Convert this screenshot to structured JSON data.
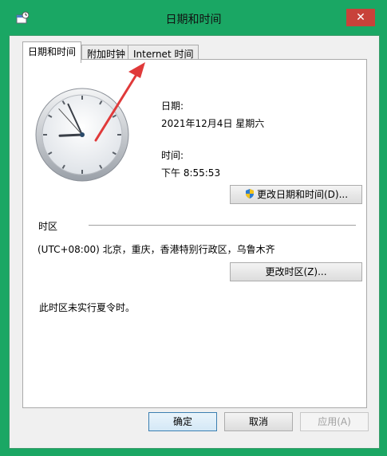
{
  "window": {
    "title": "日期和时间"
  },
  "tabs": [
    {
      "label": "日期和时间"
    },
    {
      "label": "附加时钟"
    },
    {
      "label": "Internet 时间"
    }
  ],
  "date": {
    "label": "日期:",
    "value": "2021年12月4日 星期六"
  },
  "time": {
    "label": "时间:",
    "value": "下午 8:55:53"
  },
  "buttons": {
    "change_datetime": "更改日期和时间(D)...",
    "change_timezone": "更改时区(Z)...",
    "ok": "确定",
    "cancel": "取消",
    "apply": "应用(A)"
  },
  "timezone": {
    "heading": "时区",
    "value": "(UTC+08:00) 北京，重庆，香港特别行政区，乌鲁木齐",
    "dst_note": "此时区未实行夏令时。"
  },
  "clock": {
    "hour": 8,
    "minute": 55,
    "second": 53
  },
  "colors": {
    "frame": "#1aa764",
    "close": "#c8423a",
    "arrow": "#e03a3a"
  }
}
